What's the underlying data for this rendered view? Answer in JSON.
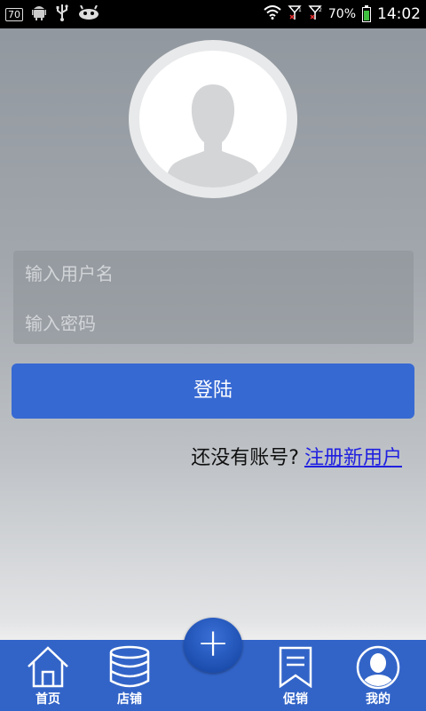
{
  "status_bar": {
    "badge": "70",
    "battery_percent": "70%",
    "battery_level": 0.7,
    "time": "14:02",
    "icons": [
      "android-icon",
      "usb-icon",
      "bug-icon",
      "wifi-icon",
      "signal-1-icon",
      "signal-2-icon",
      "battery-icon"
    ]
  },
  "login": {
    "username_placeholder": "输入用户名",
    "password_placeholder": "输入密码",
    "login_button": "登陆",
    "no_account_text": "还没有账号?",
    "register_link": "注册新用户"
  },
  "bottom_nav": {
    "items": [
      {
        "label": "首页",
        "icon": "home-icon"
      },
      {
        "label": "店铺",
        "icon": "database-icon"
      },
      {
        "label": "促销",
        "icon": "bookmark-icon"
      },
      {
        "label": "我的",
        "icon": "user-icon"
      }
    ],
    "fab_label": "+"
  },
  "colors": {
    "accent": "#3769d3",
    "nav_bg": "#3264c8",
    "link": "#2020e0"
  }
}
